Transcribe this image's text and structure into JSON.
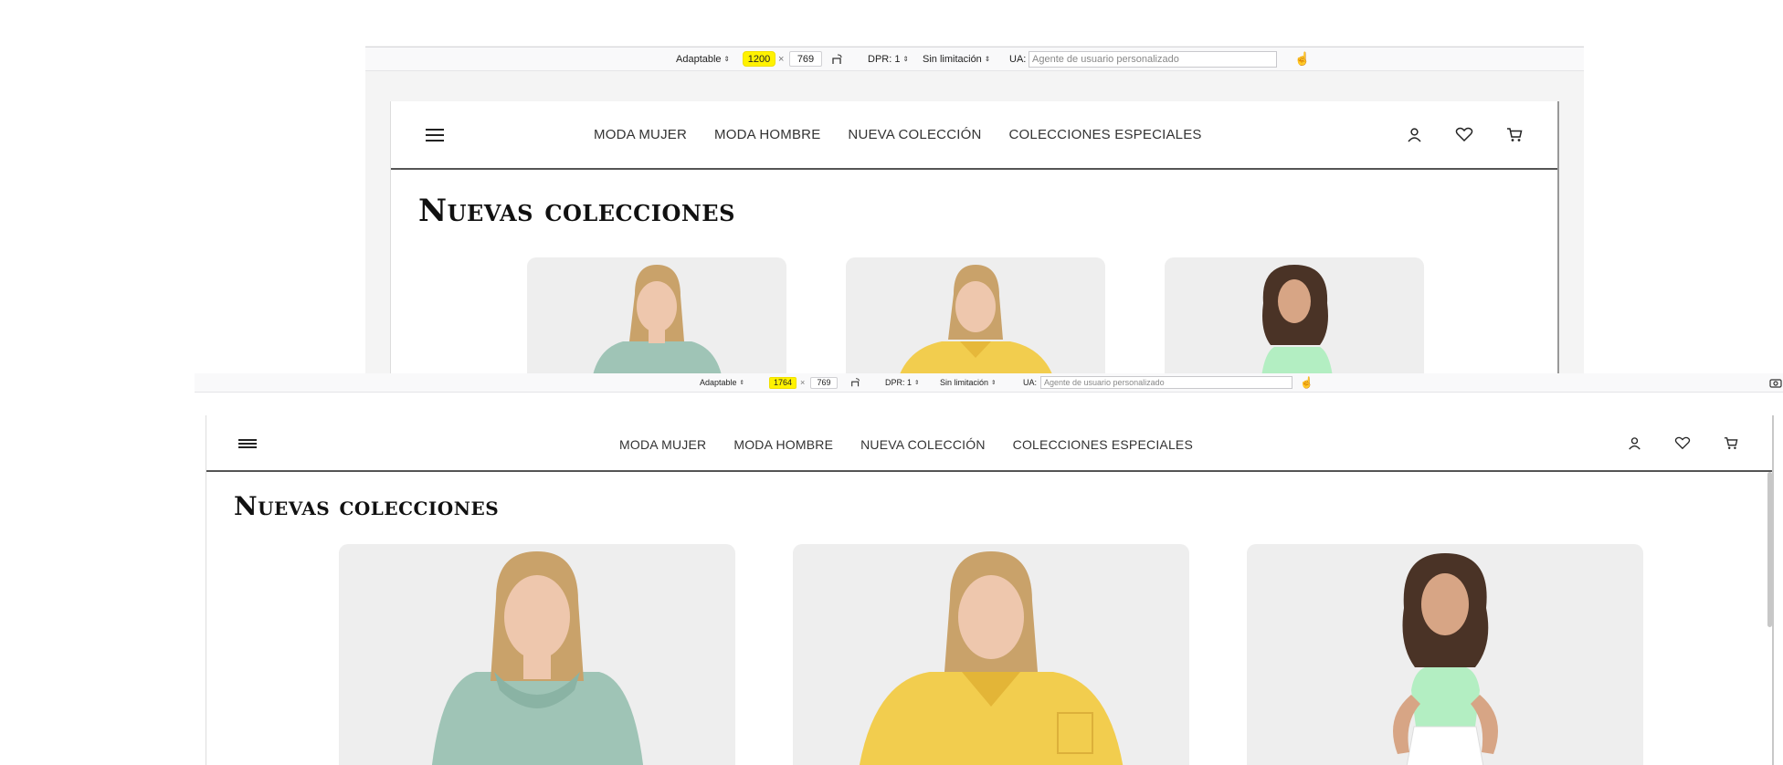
{
  "toolbar": {
    "device_mode": "Adaptable",
    "width_small": "1200",
    "width_large": "1764",
    "separator": "×",
    "height": "769",
    "dpr": "DPR: 1",
    "throttling": "Sin limitación",
    "ua_label": "UA:",
    "ua_placeholder": "Agente de usuario personalizado",
    "highlight_color": "#fff200"
  },
  "site": {
    "nav": [
      "MODA MUJER",
      "MODA HOMBRE",
      "NUEVA COLECCIÓN",
      "COLECCIONES ESPECIALES"
    ],
    "title": "Nuevas colecciones",
    "icons": [
      "menu-icon",
      "user-icon",
      "heart-icon",
      "cart-icon"
    ],
    "products": [
      {
        "name": "sage-tank-top",
        "color": "#9fc4b6"
      },
      {
        "name": "yellow-shirt",
        "color": "#f2cd4e"
      },
      {
        "name": "mint-halter-top",
        "color": "#b3eec2"
      }
    ]
  }
}
